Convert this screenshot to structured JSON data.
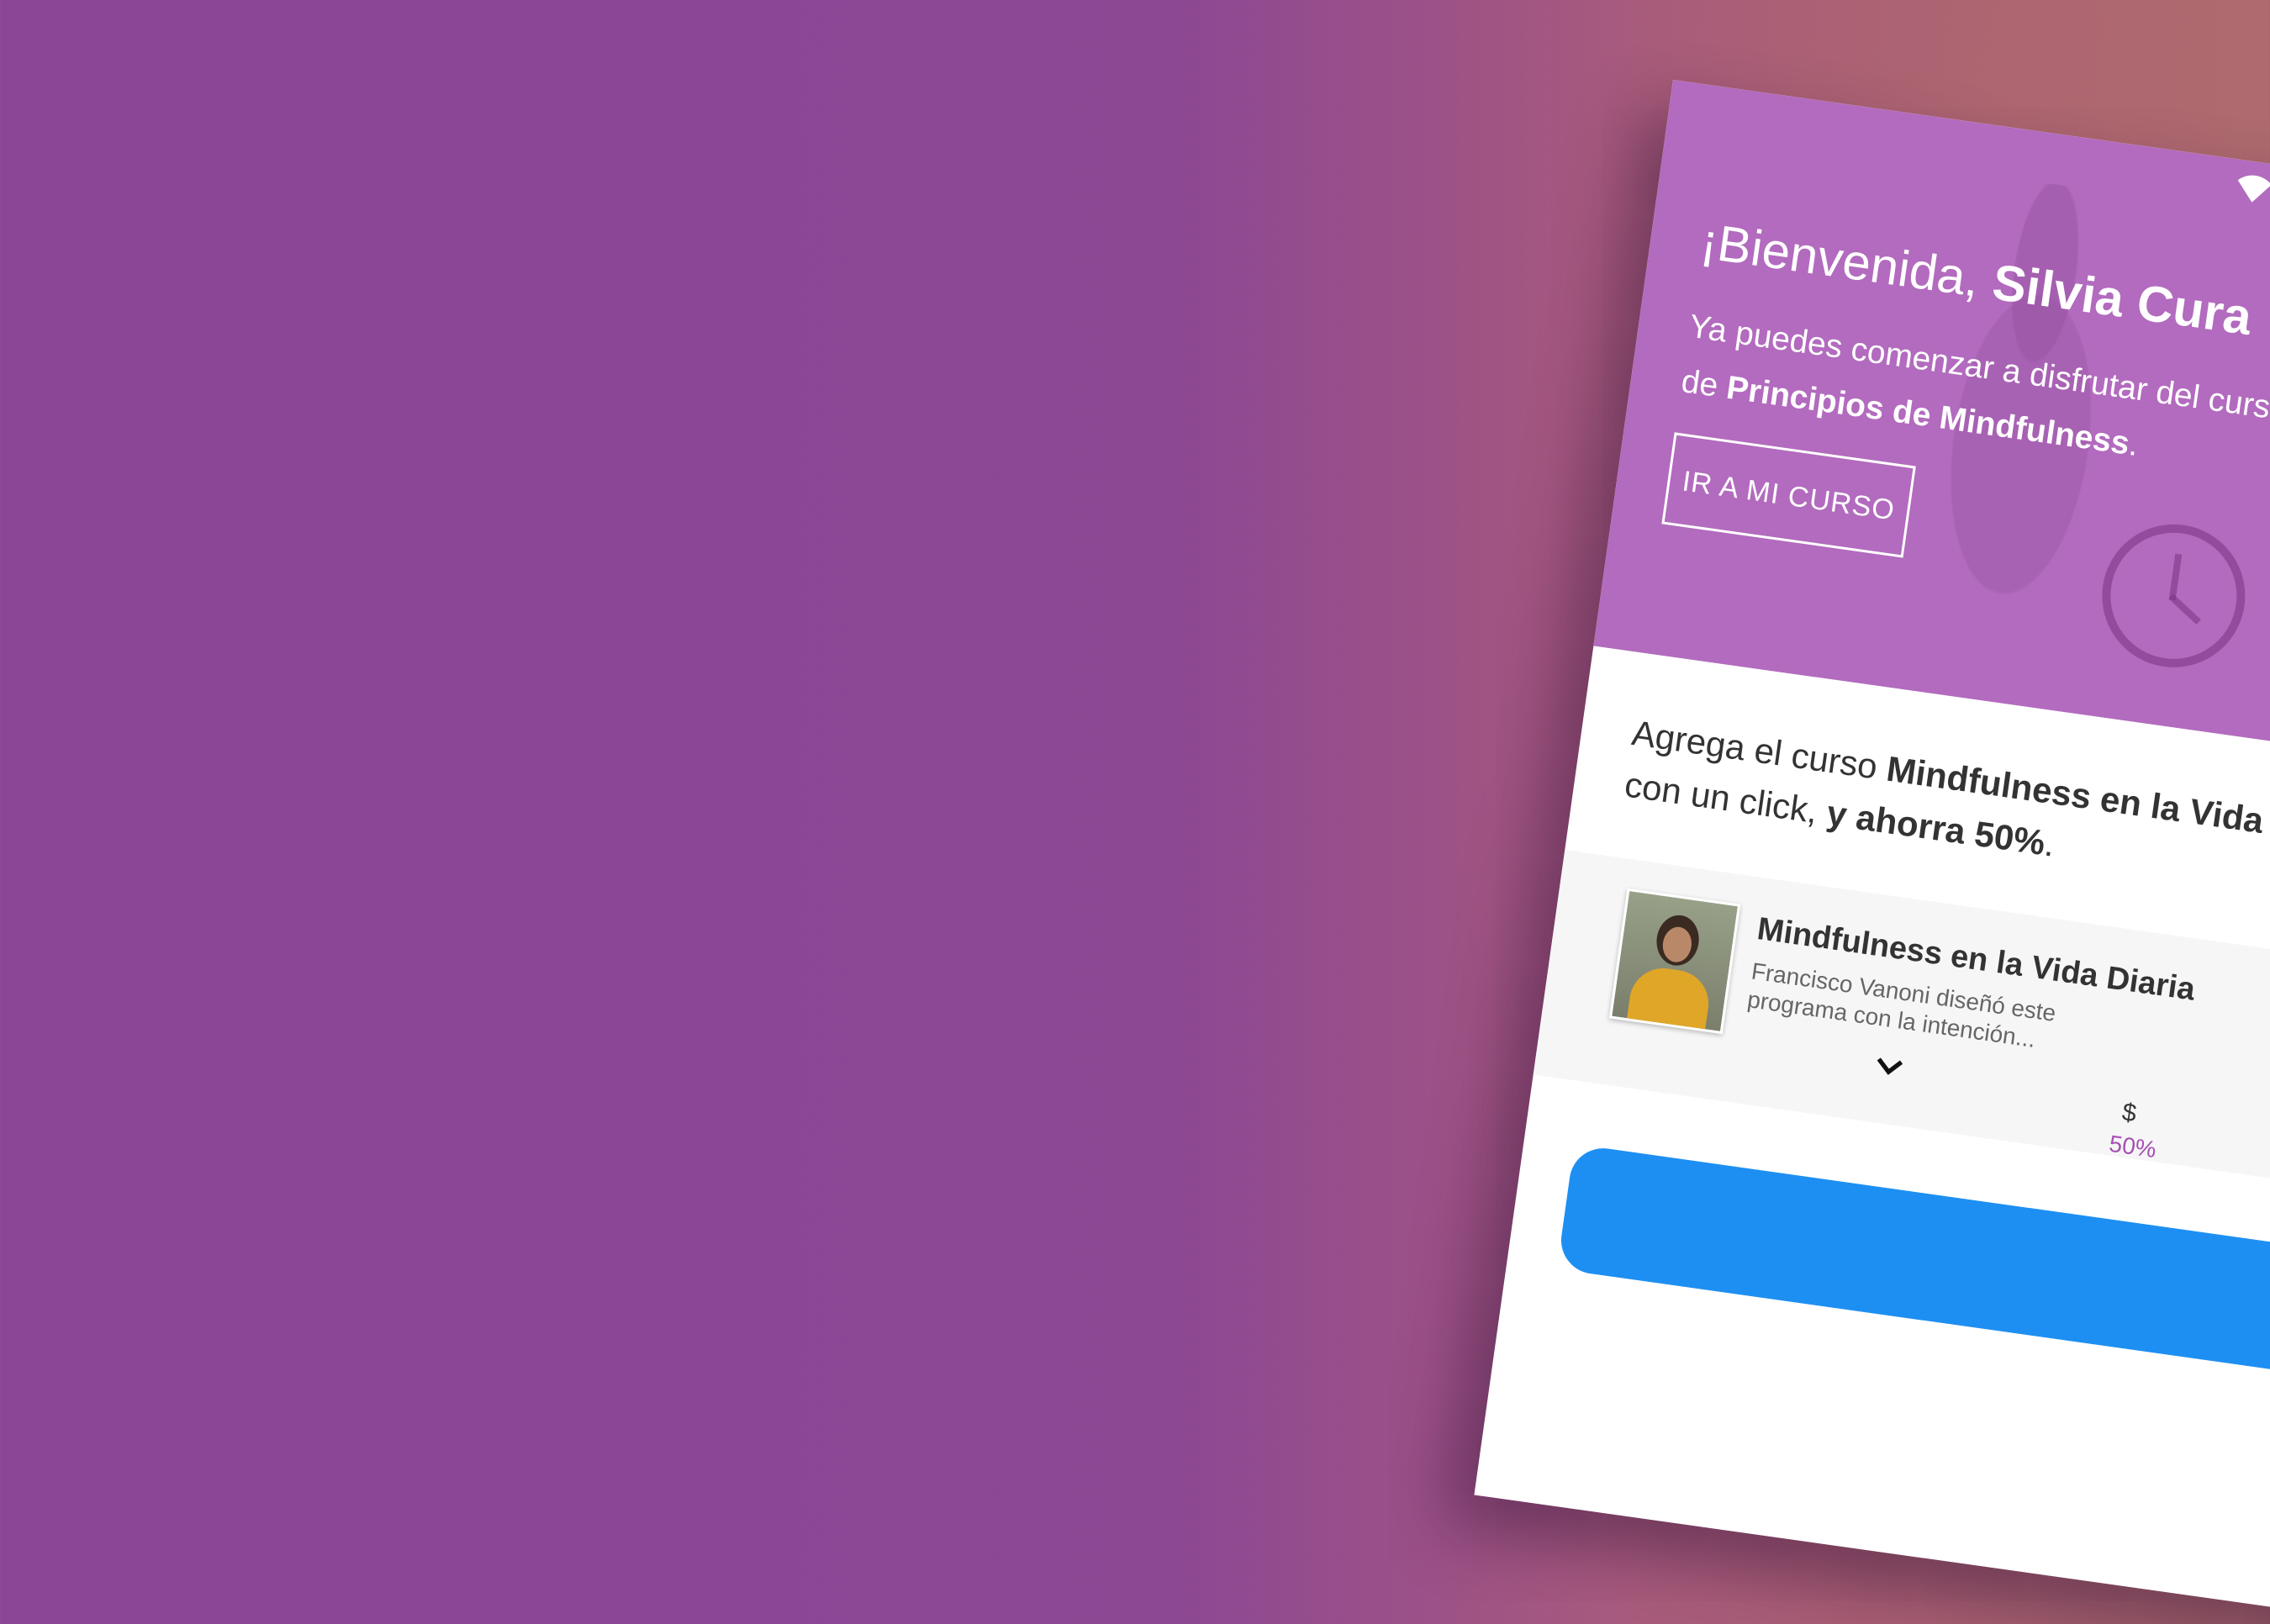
{
  "hero": {
    "greeting": "¡Bienvenida, ",
    "name": "Silvia Cura",
    "text_prefix": "Ya puedes comenzar a disfrutar del curso ",
    "text_mid": "de ",
    "course_name": "Principios de Mindfulness",
    "text_suffix": ".",
    "button_label": "IR A MI CURSO"
  },
  "offer": {
    "text_prefix": "Agrega el curso ",
    "course_name": "Mindfulness en la Vida Diaria",
    "text_mid": " con un click, ",
    "savings": "y ahorra 50%",
    "text_suffix": "."
  },
  "course_card": {
    "title": "Mindfulness en la Vida Diaria",
    "description": "Francisco Vanoni diseñó este programa con la intención...",
    "price_partial": "$",
    "discount_partial": "50%"
  },
  "colors": {
    "background_start": "#8b4796",
    "background_end": "#ad6a6e",
    "hero": "#b26bbe",
    "cta": "#1d8ff2",
    "accent": "#a64fb3"
  },
  "icons": [
    "wifi-icon",
    "chevron-down-icon",
    "alarm-clock-illustration"
  ]
}
